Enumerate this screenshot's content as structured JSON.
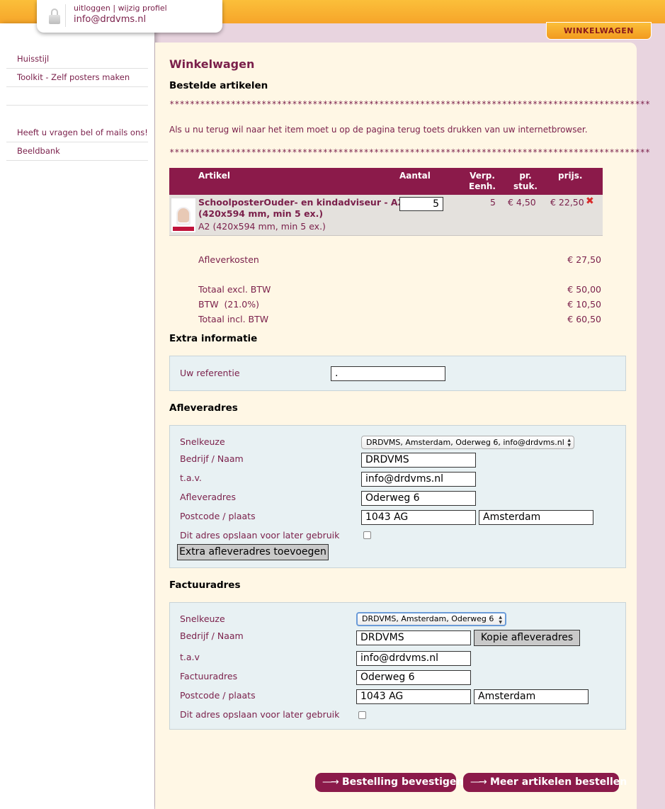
{
  "header": {
    "logout_label": "uitloggen",
    "edit_profile_label": "wijzig profiel",
    "link_separator": "|",
    "user_email": "info@drdvms.nl",
    "cart_tab_label": "WINKELWAGEN"
  },
  "sidebar": {
    "items": [
      {
        "label": "Huisstijl"
      },
      {
        "label": "Toolkit - Zelf posters maken"
      },
      {
        "label": ""
      },
      {
        "label": "Heeft u vragen bel of mails ons!"
      },
      {
        "label": "Beeldbank"
      }
    ]
  },
  "page": {
    "title": "Winkelwagen",
    "ordered_heading": "Bestelde artikelen",
    "stars": "**********************************************************************************************",
    "back_note": "Als u nu terug wil naar het item moet u op de pagina terug toets drukken van uw internetbrowser."
  },
  "table": {
    "headers": {
      "article": "Artikel",
      "quantity": "Aantal",
      "unit_line1": "Verp.",
      "unit_line2": "Eenh.",
      "price_line1": "pr.",
      "price_line2": "stuk.",
      "total": "prijs."
    },
    "rows": [
      {
        "name_line1": "SchoolposterOuder- en kindadviseur - A2",
        "name_line2": "(420x594 mm, min 5 ex.)",
        "subtitle": "A2 (420x594 mm, min 5 ex.)",
        "quantity": "5",
        "unit": "5",
        "price_each": "€ 4,50",
        "price_total": "€ 22,50",
        "remove_icon": "✖"
      }
    ]
  },
  "totals": {
    "delivery_label": "Afleverkosten",
    "delivery_value": "€ 27,50",
    "excl_label": "Totaal excl. BTW",
    "excl_value": "€ 50,00",
    "vat_label": "BTW  (21.0%)",
    "vat_value": "€ 10,50",
    "incl_label": "Totaal incl. BTW",
    "incl_value": "€ 60,50"
  },
  "extra": {
    "heading": "Extra informatie",
    "reference_label": "Uw referentie",
    "reference_value": "."
  },
  "delivery": {
    "heading": "Afleveradres",
    "quick_label": "Snelkeuze",
    "quick_value": "DRDVMS, Amsterdam, Oderweg 6, info@drdvms.nl",
    "company_label": "Bedrijf / Naam",
    "company_value": "DRDVMS",
    "attn_label": "t.a.v.",
    "attn_value": "info@drdvms.nl",
    "address_label": "Afleveradres",
    "address_value": "Oderweg 6",
    "postcode_label": "Postcode / plaats",
    "postcode_value": "1043 AG",
    "city_value": "Amsterdam",
    "save_label": "Dit adres opslaan voor later gebruik",
    "add_button": "Extra afleveradres toevoegen"
  },
  "billing": {
    "heading": "Factuuradres",
    "quick_label": "Snelkeuze",
    "quick_value": "DRDVMS, Amsterdam, Oderweg 6",
    "company_label": "Bedrijf / Naam",
    "company_value": "DRDVMS",
    "copy_button": "Kopie afleveradres",
    "attn_label": "t.a.v",
    "attn_value": "info@drdvms.nl",
    "address_label": "Factuuradres",
    "address_value": "Oderweg 6",
    "postcode_label": "Postcode / plaats",
    "postcode_value": "1043 AG",
    "city_value": "Amsterdam",
    "save_label": "Dit adres opslaan voor later gebruik"
  },
  "actions": {
    "confirm_label": "Bestelling bevestigen",
    "more_label": "Meer artikelen bestellen",
    "arrow_glyph": "—→"
  },
  "colors": {
    "brand": "#8b1a4a",
    "accent_orange": "#f6a52a",
    "panel_bg": "#fff7e5",
    "form_bg": "#e8f1f3"
  }
}
